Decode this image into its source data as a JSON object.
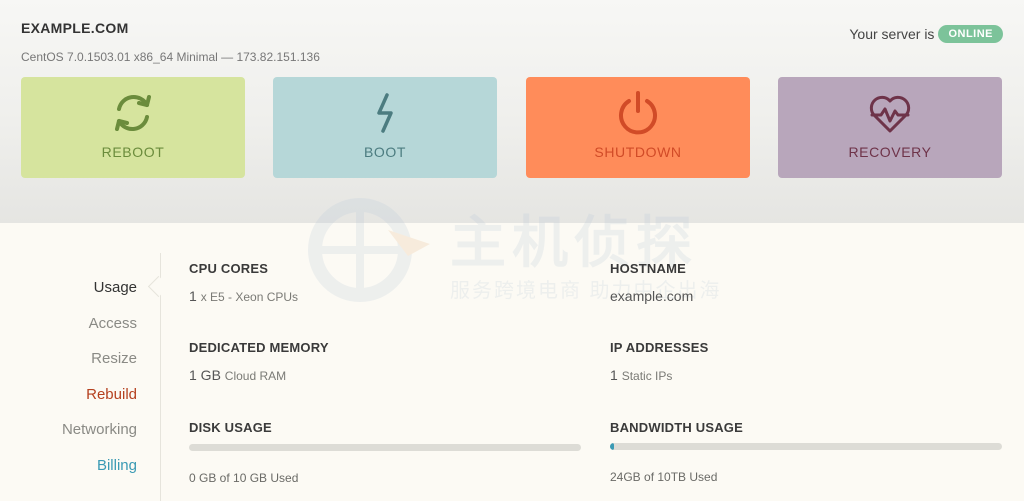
{
  "server": {
    "domain": "EXAMPLE.COM",
    "os_info": "CentOS 7.0.1503.01 x86_64 Minimal — 173.82.151.136",
    "status_prefix": "Your server is",
    "status": "ONLINE",
    "status_color": "#7cc39a"
  },
  "actions": [
    {
      "label": "REBOOT",
      "icon": "reboot-icon",
      "bg": "#d6e49e",
      "fg": "#6b8c3c"
    },
    {
      "label": "BOOT",
      "icon": "lightning-icon",
      "bg": "#b6d7d8",
      "fg": "#4c7c80"
    },
    {
      "label": "SHUTDOWN",
      "icon": "power-icon",
      "bg": "#ff8c5a",
      "fg": "#d14b27"
    },
    {
      "label": "RECOVERY",
      "icon": "heart-pulse-icon",
      "bg": "#b8a6bb",
      "fg": "#6e3349"
    }
  ],
  "nav": [
    {
      "label": "Usage",
      "state": "active"
    },
    {
      "label": "Access",
      "state": ""
    },
    {
      "label": "Resize",
      "state": ""
    },
    {
      "label": "Rebuild",
      "state": "danger"
    },
    {
      "label": "Networking",
      "state": ""
    },
    {
      "label": "Billing",
      "state": "billing"
    }
  ],
  "stats": {
    "cpu": {
      "title": "CPU CORES",
      "value": "1",
      "detail": "x E5 - Xeon CPUs"
    },
    "memory": {
      "title": "DEDICATED MEMORY",
      "value": "1 GB",
      "detail": "Cloud RAM"
    },
    "disk": {
      "title": "DISK USAGE",
      "usage": "0 GB of 10 GB Used",
      "fraction": 0.0,
      "fill_color": "#c9c7c0"
    },
    "hostname": {
      "title": "HOSTNAME",
      "value": "example.com"
    },
    "ip": {
      "title": "IP ADDRESSES",
      "value": "1",
      "detail": "Static IPs"
    },
    "bandwidth": {
      "title": "BANDWIDTH USAGE",
      "usage": "24GB of 10TB Used",
      "fraction": 0.0024,
      "fill_color": "#3a9ab4"
    }
  },
  "watermark": {
    "title": "主机侦探",
    "subtitle": "服务跨境电商 助力中企出海"
  }
}
